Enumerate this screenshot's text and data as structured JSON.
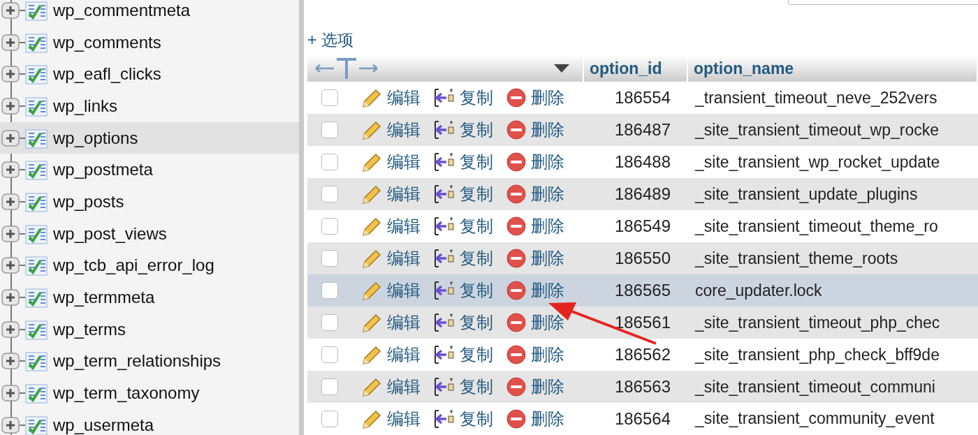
{
  "sidebar": {
    "tables": [
      {
        "name": "wp_commentmeta",
        "selected": false
      },
      {
        "name": "wp_comments",
        "selected": false
      },
      {
        "name": "wp_eafl_clicks",
        "selected": false
      },
      {
        "name": "wp_links",
        "selected": false
      },
      {
        "name": "wp_options",
        "selected": true
      },
      {
        "name": "wp_postmeta",
        "selected": false
      },
      {
        "name": "wp_posts",
        "selected": false
      },
      {
        "name": "wp_post_views",
        "selected": false
      },
      {
        "name": "wp_tcb_api_error_log",
        "selected": false
      },
      {
        "name": "wp_termmeta",
        "selected": false
      },
      {
        "name": "wp_terms",
        "selected": false
      },
      {
        "name": "wp_term_relationships",
        "selected": false
      },
      {
        "name": "wp_term_taxonomy",
        "selected": false
      },
      {
        "name": "wp_usermeta",
        "selected": false
      }
    ]
  },
  "options_link": "+ 选项",
  "table": {
    "columns": [
      "option_id",
      "option_name"
    ],
    "rows": [
      {
        "checked": false,
        "selected": false,
        "edit": "编辑",
        "copy": "复制",
        "delete": "删除",
        "option_id": "186554",
        "option_name": "_transient_timeout_neve_252vers"
      },
      {
        "checked": false,
        "selected": false,
        "edit": "编辑",
        "copy": "复制",
        "delete": "删除",
        "option_id": "186487",
        "option_name": "_site_transient_timeout_wp_rocke"
      },
      {
        "checked": false,
        "selected": false,
        "edit": "编辑",
        "copy": "复制",
        "delete": "删除",
        "option_id": "186488",
        "option_name": "_site_transient_wp_rocket_update"
      },
      {
        "checked": false,
        "selected": false,
        "edit": "编辑",
        "copy": "复制",
        "delete": "删除",
        "option_id": "186489",
        "option_name": "_site_transient_update_plugins"
      },
      {
        "checked": false,
        "selected": false,
        "edit": "编辑",
        "copy": "复制",
        "delete": "删除",
        "option_id": "186549",
        "option_name": "_site_transient_timeout_theme_ro"
      },
      {
        "checked": false,
        "selected": false,
        "edit": "编辑",
        "copy": "复制",
        "delete": "删除",
        "option_id": "186550",
        "option_name": "_site_transient_theme_roots"
      },
      {
        "checked": false,
        "selected": true,
        "edit": "编辑",
        "copy": "复制",
        "delete": "删除",
        "option_id": "186565",
        "option_name": "core_updater.lock"
      },
      {
        "checked": false,
        "selected": false,
        "edit": "编辑",
        "copy": "复制",
        "delete": "删除",
        "option_id": "186561",
        "option_name": "_site_transient_timeout_php_chec"
      },
      {
        "checked": false,
        "selected": false,
        "edit": "编辑",
        "copy": "复制",
        "delete": "删除",
        "option_id": "186562",
        "option_name": "_site_transient_php_check_bff9de"
      },
      {
        "checked": false,
        "selected": false,
        "edit": "编辑",
        "copy": "复制",
        "delete": "删除",
        "option_id": "186563",
        "option_name": "_site_transient_timeout_communi"
      },
      {
        "checked": false,
        "selected": false,
        "edit": "编辑",
        "copy": "复制",
        "delete": "删除",
        "option_id": "186564",
        "option_name": "_site_transient_community_event"
      }
    ]
  }
}
